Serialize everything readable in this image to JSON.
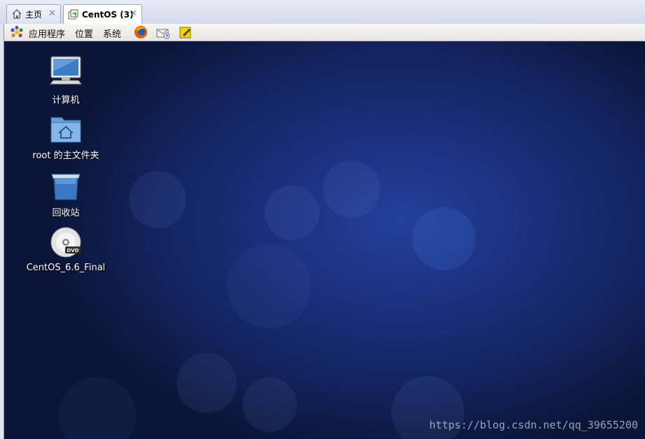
{
  "tabs": [
    {
      "label": "主页",
      "icon": "home-icon"
    },
    {
      "label": "CentOS (3)",
      "icon": "vm-icon"
    }
  ],
  "panel": {
    "menus": [
      "应用程序",
      "位置",
      "系统"
    ],
    "launchers": [
      "firefox-icon",
      "mail-icon",
      "notes-icon"
    ]
  },
  "desktop": {
    "icons": [
      {
        "label": "计算机",
        "icon": "computer-icon"
      },
      {
        "label": "root 的主文件夹",
        "icon": "home-folder-icon"
      },
      {
        "label": "回收站",
        "icon": "trash-icon"
      },
      {
        "label": "CentOS_6.6_Final",
        "icon": "dvd-icon"
      }
    ]
  },
  "watermark": "https://blog.csdn.net/qq_39655200"
}
